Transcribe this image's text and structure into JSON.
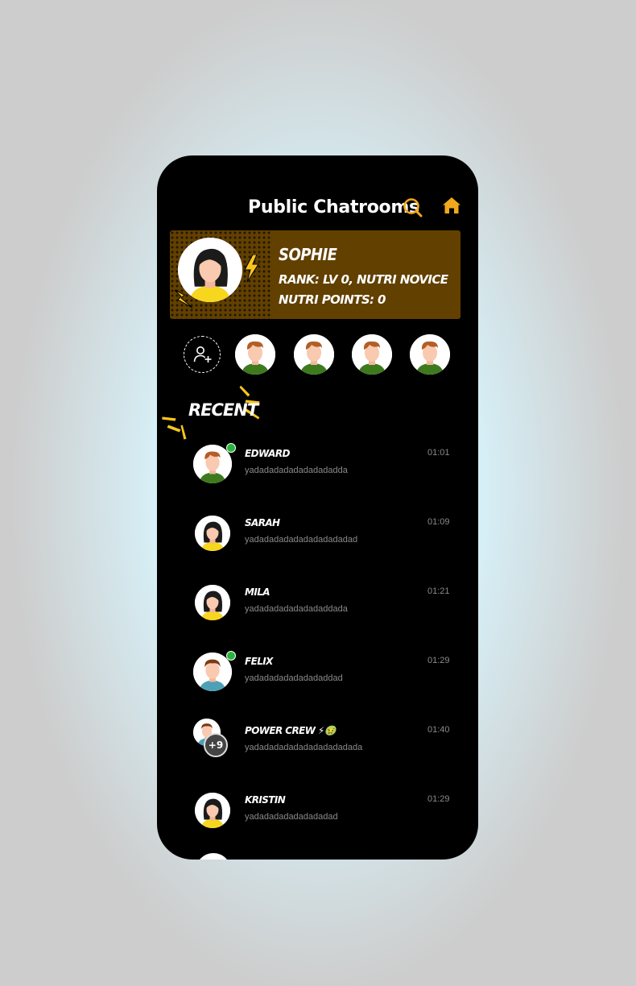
{
  "header": {
    "title": "Public Chatrooms",
    "search_icon": "search-icon",
    "home_icon": "home-icon",
    "accent_color": "#f2a81d"
  },
  "profile": {
    "name": "SOPHIE",
    "rank": "RANK: LV 0, NUTRI NOVICE",
    "points": "NUTRI POINTS: 0",
    "card_color": "#624000"
  },
  "friends_row": {
    "add_icon": "add-user-icon"
  },
  "recent": {
    "heading": "RECENT"
  },
  "chats": [
    {
      "name": "EDWARD",
      "message": "yadadadadadadadadadda",
      "time": "01:01"
    },
    {
      "name": "SARAH",
      "message": "yadadadadadadadadadadad",
      "time": "01:09"
    },
    {
      "name": "MILA",
      "message": "yadadadadadadadaddada",
      "time": "01:21"
    },
    {
      "name": "FELIX",
      "message": "yadadadadadadadaddad",
      "time": "01:29"
    },
    {
      "name": "POWER CREW ⚡🤢",
      "message": "yadadadadadadadadadadada",
      "time": "01:40",
      "member_badge": "+9"
    },
    {
      "name": "KRISTIN",
      "message": "yadadadadadadadadad",
      "time": "01:29"
    }
  ]
}
